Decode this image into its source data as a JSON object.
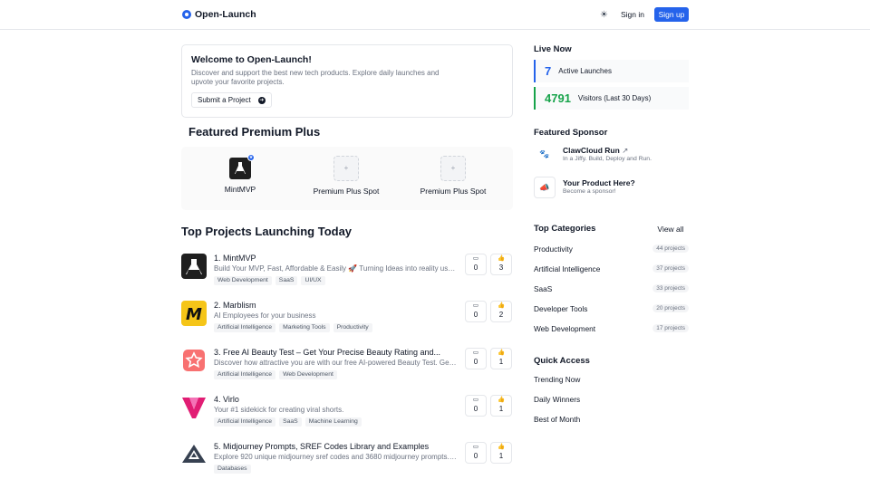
{
  "header": {
    "brand": "Open-Launch",
    "signin": "Sign in",
    "signup": "Sign up",
    "theme_icon": "sun-icon"
  },
  "welcome": {
    "title": "Welcome to Open-Launch!",
    "text": "Discover and support the best new tech products. Explore daily launches and upvote your favorite projects.",
    "submit_label": "Submit a Project"
  },
  "featured_premium": {
    "title": "Featured Premium Plus",
    "items": [
      {
        "name": "MintMVP",
        "icon": "flask-icon"
      },
      {
        "name": "Premium Plus Spot",
        "icon": "plus-icon"
      },
      {
        "name": "Premium Plus Spot",
        "icon": "plus-icon"
      }
    ]
  },
  "projects": {
    "title": "Top Projects Launching Today",
    "items": [
      {
        "title": "1. MintMVP",
        "desc": "Build Your MVP, Fast, Affordable & Easily 🚀 Turning Ideas into reality using our...",
        "tags": [
          "Web Development",
          "SaaS",
          "UI/UX"
        ],
        "comments": "0",
        "upvotes": "3",
        "logo_color": "#1f1f1f"
      },
      {
        "title": "2. Marblism",
        "desc": "AI Employees for your business",
        "tags": [
          "Artificial Intelligence",
          "Marketing Tools",
          "Productivity"
        ],
        "comments": "0",
        "upvotes": "2",
        "logo_color": "#f5c518"
      },
      {
        "title": "3. Free AI Beauty Test – Get Your Precise Beauty Rating and...",
        "desc": "Discover how attractive you are with our free AI-powered Beauty Test. Get real...",
        "tags": [
          "Artificial Intelligence",
          "Web Development"
        ],
        "comments": "0",
        "upvotes": "1",
        "logo_color": "#f87171"
      },
      {
        "title": "4. Virlo",
        "desc": "Your #1 sidekick for creating viral shorts.",
        "tags": [
          "Artificial Intelligence",
          "SaaS",
          "Machine Learning"
        ],
        "comments": "0",
        "upvotes": "1",
        "logo_color": "#e11d74"
      },
      {
        "title": "5. Midjourney Prompts, SREF Codes Library and Examples",
        "desc": "Explore 920 unique midjourney sref codes and 3680 midjourney prompts. Use...",
        "tags": [
          "Databases"
        ],
        "comments": "0",
        "upvotes": "1",
        "logo_color": "#374151"
      }
    ]
  },
  "live_now": {
    "title": "Live Now",
    "active": {
      "count": "7",
      "label": "Active Launches",
      "color": "#2563eb"
    },
    "visitors": {
      "count": "4791",
      "label": "Visitors (Last 30 Days)",
      "color": "#16a34a"
    }
  },
  "sponsor": {
    "title": "Featured Sponsor",
    "items": [
      {
        "name": "ClawCloud Run",
        "desc": "In a Jiffy. Build, Deploy and Run.",
        "icon": "paw-icon"
      },
      {
        "name": "Your Product Here?",
        "desc": "Become a sponsor!",
        "icon": "megaphone-icon"
      }
    ]
  },
  "categories": {
    "title": "Top Categories",
    "view_all": "View all",
    "items": [
      {
        "name": "Productivity",
        "count": "44 projects"
      },
      {
        "name": "Artificial Intelligence",
        "count": "37 projects"
      },
      {
        "name": "SaaS",
        "count": "33 projects"
      },
      {
        "name": "Developer Tools",
        "count": "20 projects"
      },
      {
        "name": "Web Development",
        "count": "17 projects"
      }
    ]
  },
  "quick_access": {
    "title": "Quick Access",
    "items": [
      "Trending Now",
      "Daily Winners",
      "Best of Month"
    ]
  }
}
